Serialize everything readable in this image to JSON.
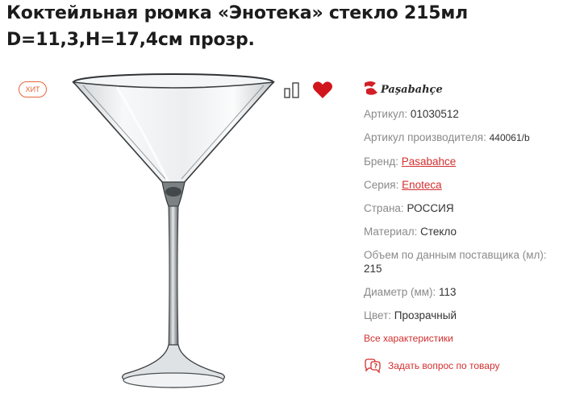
{
  "product": {
    "title": "Коктейльная рюмка «Энотека» стекло 215мл D=11,3,H=17,4см прозр.",
    "badge": "ХИТ",
    "brand_logo_text": "Paşabahçe"
  },
  "icons": {
    "compare": "compare-icon",
    "favorite": "heart-icon",
    "ask": "question-chat-icon"
  },
  "colors": {
    "accent": "#d32f2f",
    "badge": "#e8643c",
    "heart": "#d0161c"
  },
  "specs": {
    "article_label": "Артикул:",
    "article_value": "01030512",
    "mfr_article_label": "Артикул производителя:",
    "mfr_article_value": "440061/b",
    "brand_label": "Бренд:",
    "brand_value": "Pasabahce",
    "series_label": "Серия:",
    "series_value": "Enoteca",
    "country_label": "Страна:",
    "country_value": "РОССИЯ",
    "material_label": "Материал:",
    "material_value": "Стекло",
    "volume_label": "Объем по данным поставщика (мл):",
    "volume_value": "215",
    "diameter_label": "Диаметр (мм):",
    "diameter_value": "113",
    "color_label": "Цвет:",
    "color_value": "Прозрачный"
  },
  "actions": {
    "all_specs": "Все характеристики",
    "ask_question": "Задать вопрос по товару"
  }
}
